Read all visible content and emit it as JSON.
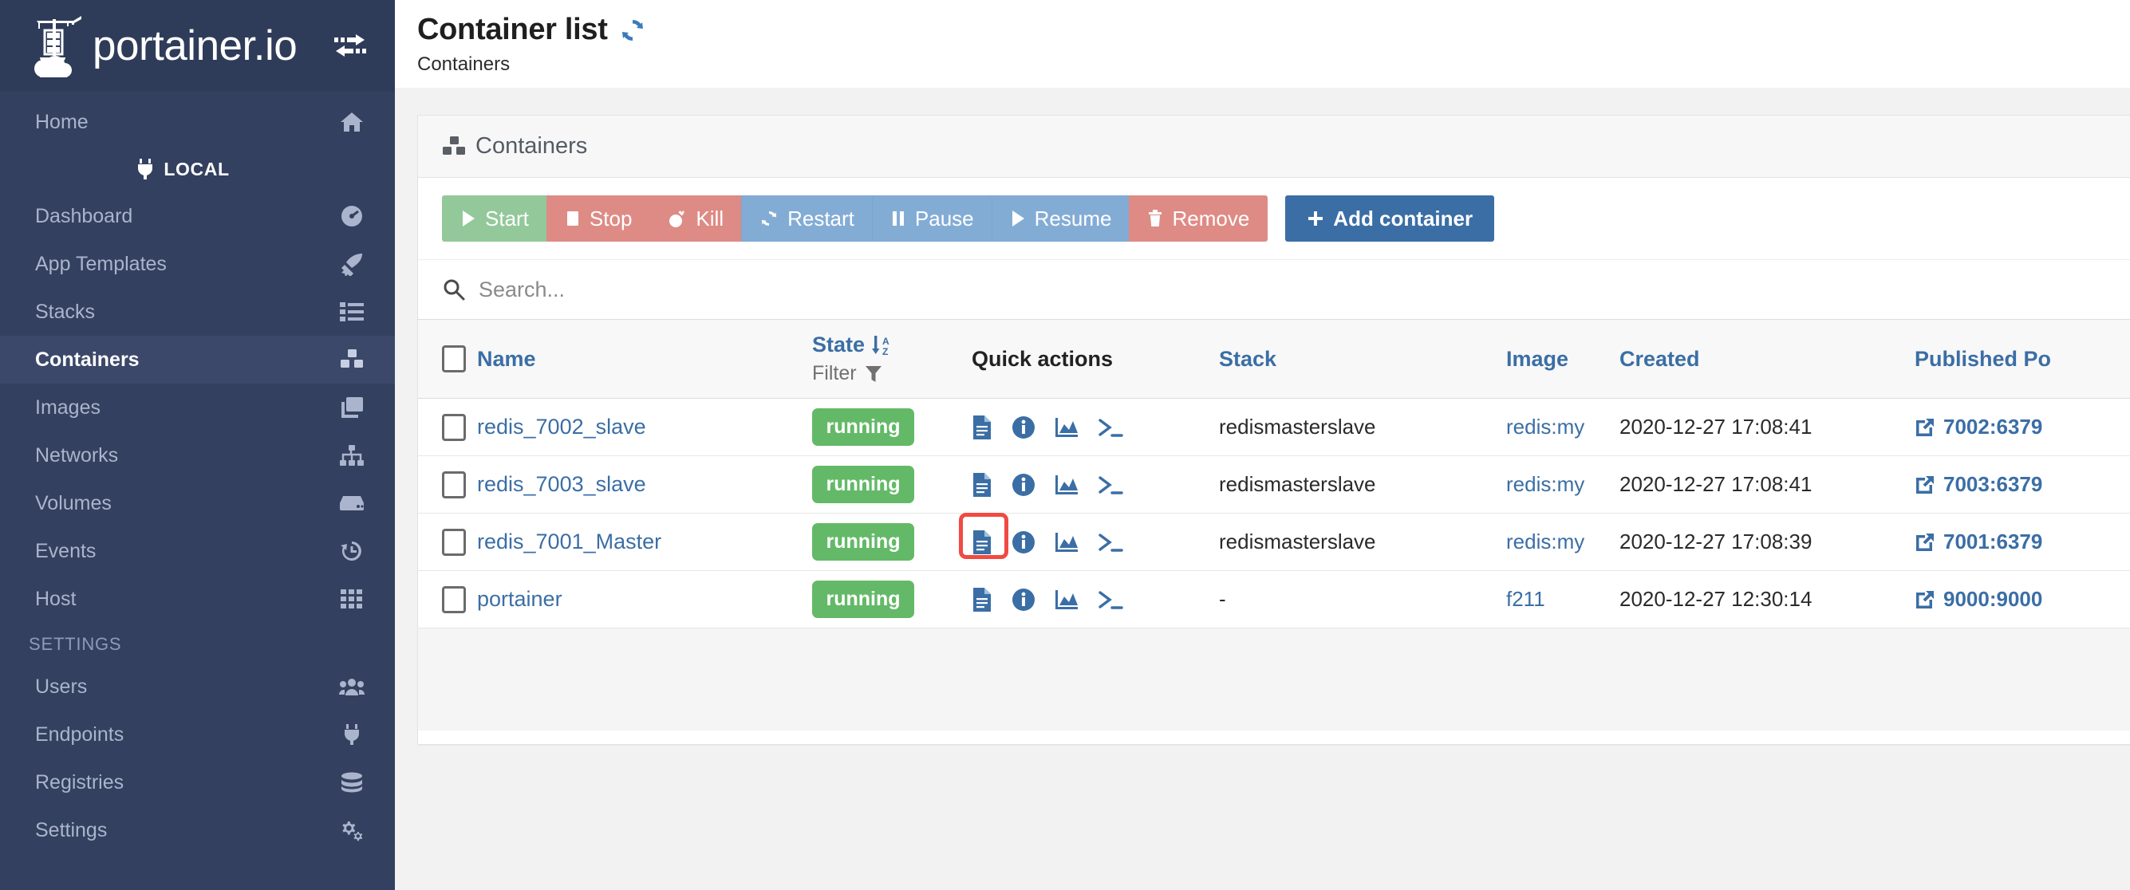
{
  "sidebar": {
    "brand": "portainer.io",
    "toggle_icon": "exchange-arrows-icon",
    "items_top": [
      {
        "label": "Home",
        "icon": "home-icon",
        "active": false
      }
    ],
    "endpoint": {
      "label": "LOCAL",
      "icon": "plug-icon"
    },
    "items_main": [
      {
        "label": "Dashboard",
        "icon": "dashboard-icon",
        "active": false
      },
      {
        "label": "App Templates",
        "icon": "rocket-icon",
        "active": false
      },
      {
        "label": "Stacks",
        "icon": "list-icon",
        "active": false
      },
      {
        "label": "Containers",
        "icon": "containers-icon",
        "active": true
      },
      {
        "label": "Images",
        "icon": "images-icon",
        "active": false
      },
      {
        "label": "Networks",
        "icon": "sitemap-icon",
        "active": false
      },
      {
        "label": "Volumes",
        "icon": "hdd-icon",
        "active": false
      },
      {
        "label": "Events",
        "icon": "history-icon",
        "active": false
      },
      {
        "label": "Host",
        "icon": "grid-icon",
        "active": false
      }
    ],
    "settings_header": "SETTINGS",
    "items_settings": [
      {
        "label": "Users",
        "icon": "users-icon",
        "active": false
      },
      {
        "label": "Endpoints",
        "icon": "plug-icon",
        "active": false
      },
      {
        "label": "Registries",
        "icon": "database-icon",
        "active": false
      },
      {
        "label": "Settings",
        "icon": "cogs-icon",
        "active": false
      }
    ]
  },
  "header": {
    "title": "Container list",
    "refresh_icon": "refresh-icon",
    "breadcrumb": "Containers"
  },
  "panel": {
    "heading_icon": "containers-icon",
    "heading_title": "Containers"
  },
  "toolbar": {
    "buttons": [
      {
        "label": "Start",
        "icon": "play-icon",
        "style": "success"
      },
      {
        "label": "Stop",
        "icon": "stop-icon",
        "style": "danger"
      },
      {
        "label": "Kill",
        "icon": "bomb-icon",
        "style": "danger"
      },
      {
        "label": "Restart",
        "icon": "sync-icon",
        "style": "info"
      },
      {
        "label": "Pause",
        "icon": "pause-icon",
        "style": "info"
      },
      {
        "label": "Resume",
        "icon": "play-icon",
        "style": "info"
      },
      {
        "label": "Remove",
        "icon": "trash-icon",
        "style": "danger"
      }
    ],
    "add_label": "Add container",
    "add_icon": "plus-icon"
  },
  "search": {
    "placeholder": "Search...",
    "value": "",
    "icon": "search-icon"
  },
  "table": {
    "columns": {
      "name": "Name",
      "state": "State",
      "state_sort_icon": "sort-alpha-down-icon",
      "filter_label": "Filter",
      "filter_icon": "funnel-icon",
      "quick_actions": "Quick actions",
      "stack": "Stack",
      "image": "Image",
      "created": "Created",
      "published_ports": "Published Po"
    },
    "quick_action_icons": [
      "logs-icon",
      "info-icon",
      "stats-chart-icon",
      "console-icon"
    ],
    "rows": [
      {
        "name": "redis_7002_slave",
        "state": "running",
        "stack": "redismasterslave",
        "image": "redis:my",
        "created": "2020-12-27 17:08:41",
        "published_ports": "7002:6379",
        "port_icon": "external-link-icon",
        "highlighted": false
      },
      {
        "name": "redis_7003_slave",
        "state": "running",
        "stack": "redismasterslave",
        "image": "redis:my",
        "created": "2020-12-27 17:08:41",
        "published_ports": "7003:6379",
        "port_icon": "external-link-icon",
        "highlighted": false
      },
      {
        "name": "redis_7001_Master",
        "state": "running",
        "stack": "redismasterslave",
        "image": "redis:my",
        "created": "2020-12-27 17:08:39",
        "published_ports": "7001:6379",
        "port_icon": "external-link-icon",
        "highlighted": true
      },
      {
        "name": "portainer",
        "state": "running",
        "stack": "-",
        "image": "f211",
        "created": "2020-12-27 12:30:14",
        "published_ports": "9000:9000",
        "port_icon": "external-link-icon",
        "highlighted": false
      }
    ]
  },
  "colors": {
    "sidebar_bg": "#33405f",
    "sidebar_active": "#3b486a",
    "link_blue": "#3b6ea5",
    "running_green": "#63b967",
    "btn_success": "#93c89a",
    "btn_danger": "#de8b85",
    "btn_info": "#83acd5",
    "highlight_red": "#f04a42"
  }
}
